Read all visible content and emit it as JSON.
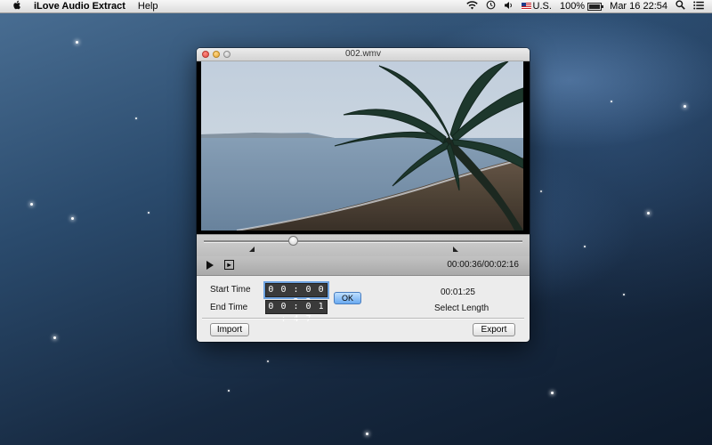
{
  "menubar": {
    "apple_icon": "apple-logo-icon",
    "app_name": "iLove Audio Extract",
    "menus": [
      "Help"
    ],
    "status": {
      "input_source": "U.S.",
      "battery": "100%",
      "battery_level": 1.0,
      "date": "Mar 16",
      "time": "22:54"
    }
  },
  "window": {
    "title": "002.wmv",
    "playback": {
      "position_fraction": 0.275,
      "time_display": "00:00:36/00:02:16"
    },
    "start_time_label": "Start Time",
    "end_time_label": "End Time",
    "start_time_value": "0 0 : 0 0 : 2 2",
    "end_time_value": "0 0 : 0 1 : 4 7",
    "ok_label": "OK",
    "select_length_value": "00:01:25",
    "select_length_label": "Select Length",
    "import_label": "Import",
    "export_label": "Export"
  },
  "colors": {
    "desktop": "#1d3550",
    "ok_button": "#6aaaf0"
  }
}
